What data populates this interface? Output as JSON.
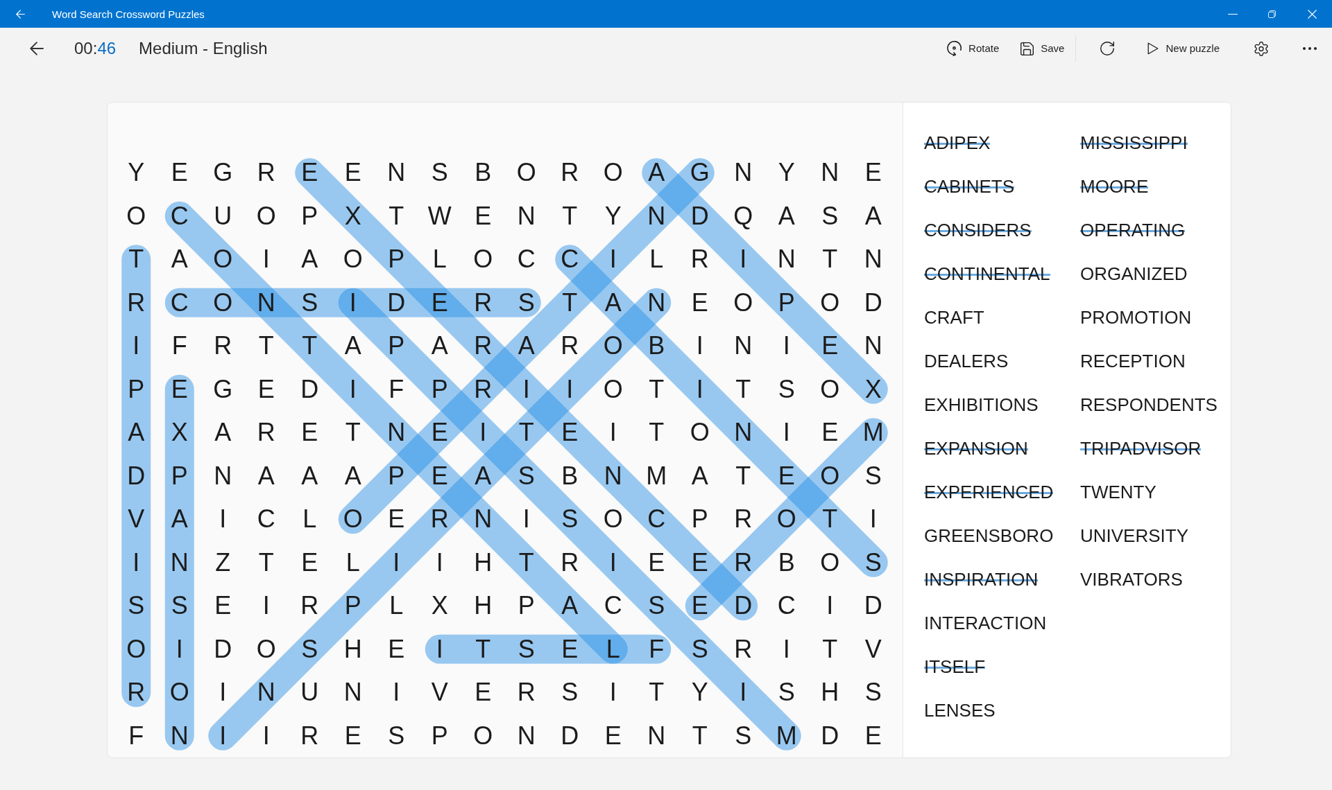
{
  "window": {
    "title": "Word Search Crossword Puzzles"
  },
  "toolbar": {
    "timer": {
      "minutes": "00:",
      "seconds": "46"
    },
    "puzzle_label": "Medium - English",
    "action_groups": [
      [
        {
          "kind": "rotate",
          "label": "Rotate"
        },
        {
          "kind": "save",
          "label": "Save"
        }
      ],
      [
        {
          "kind": "refresh"
        },
        {
          "kind": "new",
          "label": "New puzzle"
        },
        {
          "kind": "settings"
        },
        {
          "kind": "more"
        }
      ]
    ]
  },
  "grid": {
    "rows": [
      [
        "Y",
        "E",
        "G",
        "R",
        "E",
        "E",
        "N",
        "S",
        "B",
        "O",
        "R",
        "O",
        "A",
        "G",
        "N",
        "Y",
        "N",
        "E"
      ],
      [
        "O",
        "C",
        "U",
        "O",
        "P",
        "X",
        "T",
        "W",
        "E",
        "N",
        "T",
        "Y",
        "N",
        "D",
        "Q",
        "A",
        "S",
        "A"
      ],
      [
        "T",
        "A",
        "O",
        "I",
        "A",
        "O",
        "P",
        "L",
        "O",
        "C",
        "C",
        "I",
        "L",
        "R",
        "I",
        "N",
        "T",
        "N"
      ],
      [
        "R",
        "C",
        "O",
        "N",
        "S",
        "I",
        "D",
        "E",
        "R",
        "S",
        "T",
        "A",
        "N",
        "E",
        "O",
        "P",
        "O",
        "D"
      ],
      [
        "I",
        "F",
        "R",
        "T",
        "T",
        "A",
        "P",
        "A",
        "R",
        "A",
        "R",
        "O",
        "B",
        "I",
        "N",
        "I",
        "E",
        "N"
      ],
      [
        "P",
        "E",
        "G",
        "E",
        "D",
        "I",
        "F",
        "P",
        "R",
        "I",
        "I",
        "O",
        "T",
        "I",
        "T",
        "S",
        "O",
        "X"
      ],
      [
        "A",
        "X",
        "A",
        "R",
        "E",
        "T",
        "N",
        "E",
        "I",
        "T",
        "E",
        "I",
        "T",
        "O",
        "N",
        "I",
        "E",
        "M"
      ],
      [
        "D",
        "P",
        "N",
        "A",
        "A",
        "A",
        "P",
        "E",
        "A",
        "S",
        "B",
        "N",
        "M",
        "A",
        "T",
        "E",
        "O",
        "S"
      ],
      [
        "V",
        "A",
        "I",
        "C",
        "L",
        "O",
        "E",
        "R",
        "N",
        "I",
        "S",
        "O",
        "C",
        "P",
        "R",
        "O",
        "T",
        "I"
      ],
      [
        "I",
        "N",
        "Z",
        "T",
        "E",
        "L",
        "I",
        "I",
        "H",
        "T",
        "R",
        "I",
        "E",
        "E",
        "R",
        "B",
        "O",
        "S"
      ],
      [
        "S",
        "S",
        "E",
        "I",
        "R",
        "P",
        "L",
        "X",
        "H",
        "P",
        "A",
        "C",
        "S",
        "E",
        "D",
        "C",
        "I",
        "D"
      ],
      [
        "O",
        "I",
        "D",
        "O",
        "S",
        "H",
        "E",
        "I",
        "T",
        "S",
        "E",
        "L",
        "F",
        "S",
        "R",
        "I",
        "T",
        "V"
      ],
      [
        "R",
        "O",
        "I",
        "N",
        "U",
        "N",
        "I",
        "V",
        "E",
        "R",
        "S",
        "I",
        "T",
        "Y",
        "I",
        "S",
        "H",
        "S"
      ],
      [
        "F",
        "N",
        "I",
        "I",
        "R",
        "E",
        "S",
        "P",
        "O",
        "N",
        "D",
        "E",
        "N",
        "T",
        "S",
        "M",
        "D",
        "E"
      ]
    ]
  },
  "word_list": {
    "columns": [
      [
        {
          "text": "ADIPEX",
          "found": true
        },
        {
          "text": "CABINETS",
          "found": true
        },
        {
          "text": "CONSIDERS",
          "found": true
        },
        {
          "text": "CONTINENTAL",
          "found": true
        },
        {
          "text": "CRAFT",
          "found": false
        },
        {
          "text": "DEALERS",
          "found": false
        },
        {
          "text": "EXHIBITIONS",
          "found": false
        },
        {
          "text": "EXPANSION",
          "found": true
        },
        {
          "text": "EXPERIENCED",
          "found": true
        },
        {
          "text": "GREENSBORO",
          "found": false
        },
        {
          "text": "INSPIRATION",
          "found": true
        },
        {
          "text": "INTERACTION",
          "found": false
        },
        {
          "text": "ITSELF",
          "found": true
        },
        {
          "text": "LENSES",
          "found": false
        }
      ],
      [
        {
          "text": "MISSISSIPPI",
          "found": true
        },
        {
          "text": "MOORE",
          "found": true
        },
        {
          "text": "OPERATING",
          "found": true
        },
        {
          "text": "ORGANIZED",
          "found": false
        },
        {
          "text": "PROMOTION",
          "found": false
        },
        {
          "text": "RECEPTION",
          "found": false
        },
        {
          "text": "RESPONDENTS",
          "found": false
        },
        {
          "text": "TRIPADVISOR",
          "found": true
        },
        {
          "text": "TWENTY",
          "found": false
        },
        {
          "text": "UNIVERSITY",
          "found": false
        },
        {
          "text": "VIBRATORS",
          "found": false
        }
      ]
    ]
  }
}
